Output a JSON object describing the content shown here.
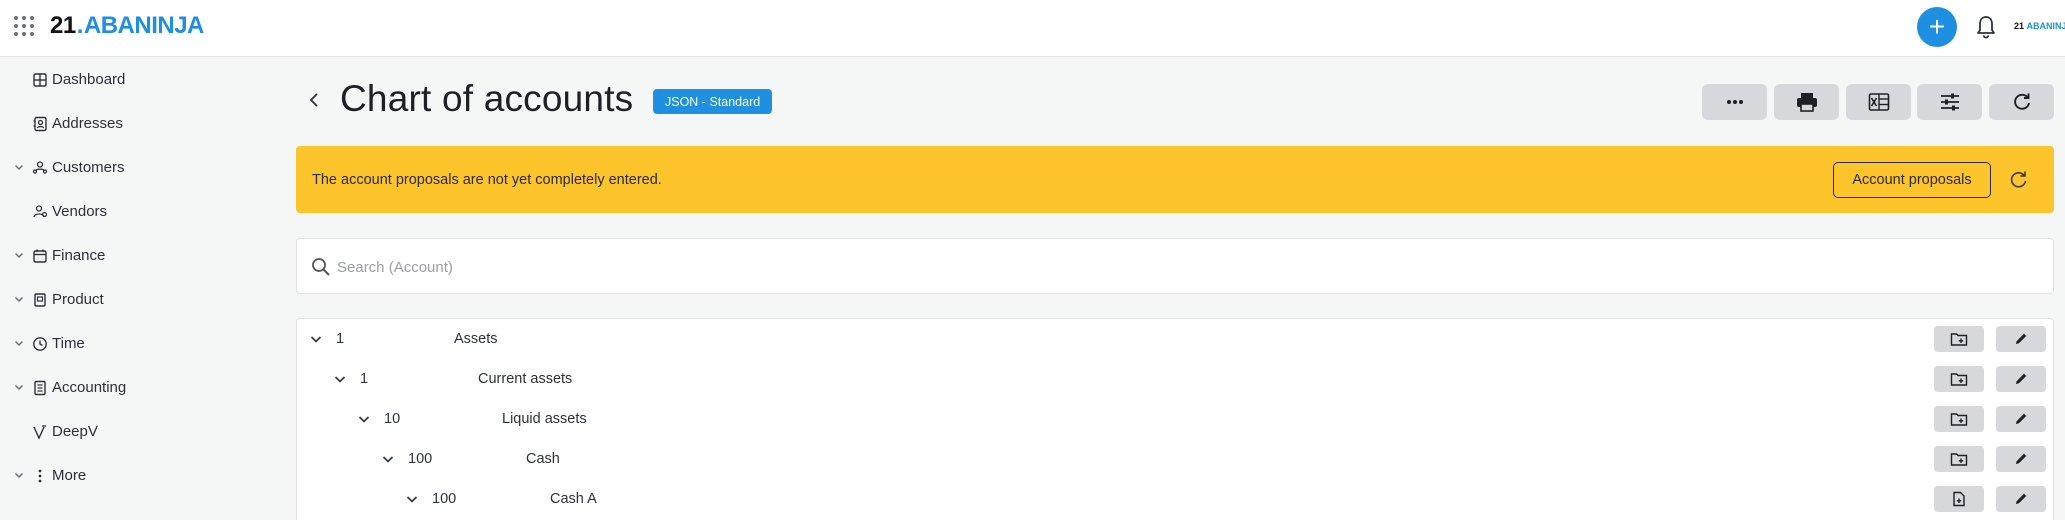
{
  "app": {
    "logo_number": "21",
    "logo_dot": ".",
    "logo_word": "ABANINJA",
    "mini_logo_number": "21",
    "mini_logo_word": "ABANINJA",
    "add_label": "+"
  },
  "sidebar": {
    "items": [
      {
        "label": "Dashboard",
        "icon": "dashboard-icon",
        "expandable": false
      },
      {
        "label": "Addresses",
        "icon": "address-book-icon",
        "expandable": false
      },
      {
        "label": "Customers",
        "icon": "customers-icon",
        "expandable": true
      },
      {
        "label": "Vendors",
        "icon": "vendors-icon",
        "expandable": false
      },
      {
        "label": "Finance",
        "icon": "finance-icon",
        "expandable": true
      },
      {
        "label": "Product",
        "icon": "product-icon",
        "expandable": true
      },
      {
        "label": "Time",
        "icon": "clock-icon",
        "expandable": true
      },
      {
        "label": "Accounting",
        "icon": "accounting-icon",
        "expandable": true
      },
      {
        "label": "DeepV",
        "icon": "deepv-icon",
        "expandable": false
      },
      {
        "label": "More",
        "icon": "more-vertical-icon",
        "expandable": true
      }
    ]
  },
  "header": {
    "title": "Chart of accounts",
    "badge": "JSON - Standard",
    "tools": [
      "more-icon",
      "print-icon",
      "excel-export-icon",
      "filter-settings-icon",
      "refresh-icon"
    ]
  },
  "banner": {
    "message": "The account proposals are not yet completely entered.",
    "button_label": "Account proposals",
    "color": "#fec42c"
  },
  "search": {
    "placeholder": "Search (Account)",
    "value": ""
  },
  "accounts": [
    {
      "number": "1",
      "name": "Assets",
      "level": 0,
      "type": "folder"
    },
    {
      "number": "1",
      "name": "Current assets",
      "level": 1,
      "type": "folder"
    },
    {
      "number": "10",
      "name": "Liquid assets",
      "level": 2,
      "type": "folder"
    },
    {
      "number": "100",
      "name": "Cash",
      "level": 3,
      "type": "folder"
    },
    {
      "number": "100",
      "name": "Cash A",
      "level": 4,
      "type": "account"
    }
  ],
  "colors": {
    "accent": "#1e8fe1",
    "warning": "#fec42c",
    "button_gray": "#d6d8db"
  }
}
